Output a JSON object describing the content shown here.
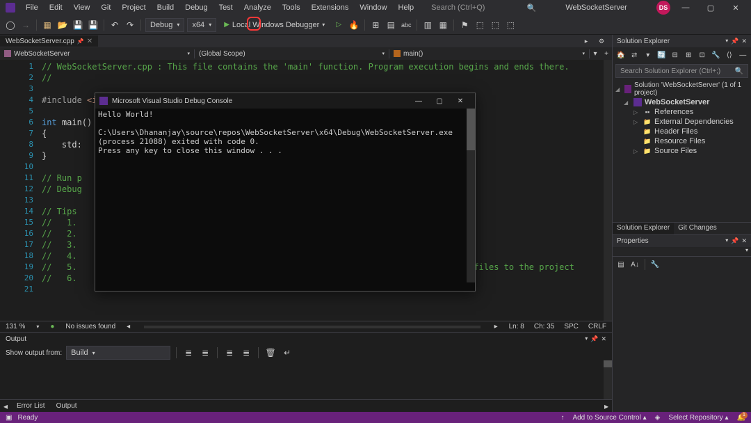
{
  "title": "WebSocketServer",
  "menu": [
    "File",
    "Edit",
    "View",
    "Git",
    "Project",
    "Build",
    "Debug",
    "Test",
    "Analyze",
    "Tools",
    "Extensions",
    "Window",
    "Help"
  ],
  "searchPlaceholder": "Search (Ctrl+Q)",
  "userInitials": "DS",
  "toolbar": {
    "config": "Debug",
    "platform": "x64",
    "debugger": "Local Windows Debugger"
  },
  "docTab": "WebSocketServer.cpp",
  "nav": {
    "project": "WebSocketServer",
    "scope": "(Global Scope)",
    "function": "main()"
  },
  "code": {
    "lines": [
      "1",
      "2",
      "3",
      "4",
      "5",
      "6",
      "7",
      "8",
      "9",
      "10",
      "11",
      "12",
      "13",
      "14",
      "15",
      "16",
      "17",
      "18",
      "19",
      "20",
      "21"
    ],
    "l1": "// WebSocketServer.cpp : This file contains the 'main' function. Program execution begins and ends there.",
    "l2": "//",
    "l4a": "#include",
    "l4b": " <iostream>",
    "l6a": "int",
    "l6b": " main()",
    "l7": "{",
    "l8a": "    std:",
    "l8b": "\"Hello World!\\n\"",
    "l9": "}",
    "l11": "// Run p",
    "l12": "// Debug",
    "l14": "// Tips ",
    "l15": "//   1. ",
    "l16": "//   2. ",
    "l17": "//   3. ",
    "l18": "//   4. ",
    "l19a": "//   5. ",
    "l19b": "ing code files to the project",
    "l20": "//   6. "
  },
  "console": {
    "title": "Microsoft Visual Studio Debug Console",
    "line1": "Hello World!",
    "line2": "",
    "line3": "C:\\Users\\Dhananjay\\source\\repos\\WebSocketServer\\x64\\Debug\\WebSocketServer.exe (process 21088) exited with code 0.",
    "line4": "Press any key to close this window . . ."
  },
  "statusStrip": {
    "zoom": "131 %",
    "issues": "No issues found",
    "line": "Ln: 8",
    "col": "Ch: 35",
    "spaces": "SPC",
    "ending": "CRLF"
  },
  "output": {
    "title": "Output",
    "showLabel": "Show output from:",
    "source": "Build",
    "tabs": [
      "Error List",
      "Output"
    ]
  },
  "bottom": {
    "status": "Ready",
    "sourceControl": "Add to Source Control",
    "repo": "Select Repository",
    "notif": "1"
  },
  "solutionExplorer": {
    "title": "Solution Explorer",
    "searchPlaceholder": "Search Solution Explorer (Ctrl+;)",
    "solution": "Solution 'WebSocketServer' (1 of 1 project)",
    "project": "WebSocketServer",
    "refs": "References",
    "extDeps": "External Dependencies",
    "headerFiles": "Header Files",
    "resourceFiles": "Resource Files",
    "sourceFiles": "Source Files",
    "tabs": [
      "Solution Explorer",
      "Git Changes"
    ]
  },
  "properties": {
    "title": "Properties"
  }
}
